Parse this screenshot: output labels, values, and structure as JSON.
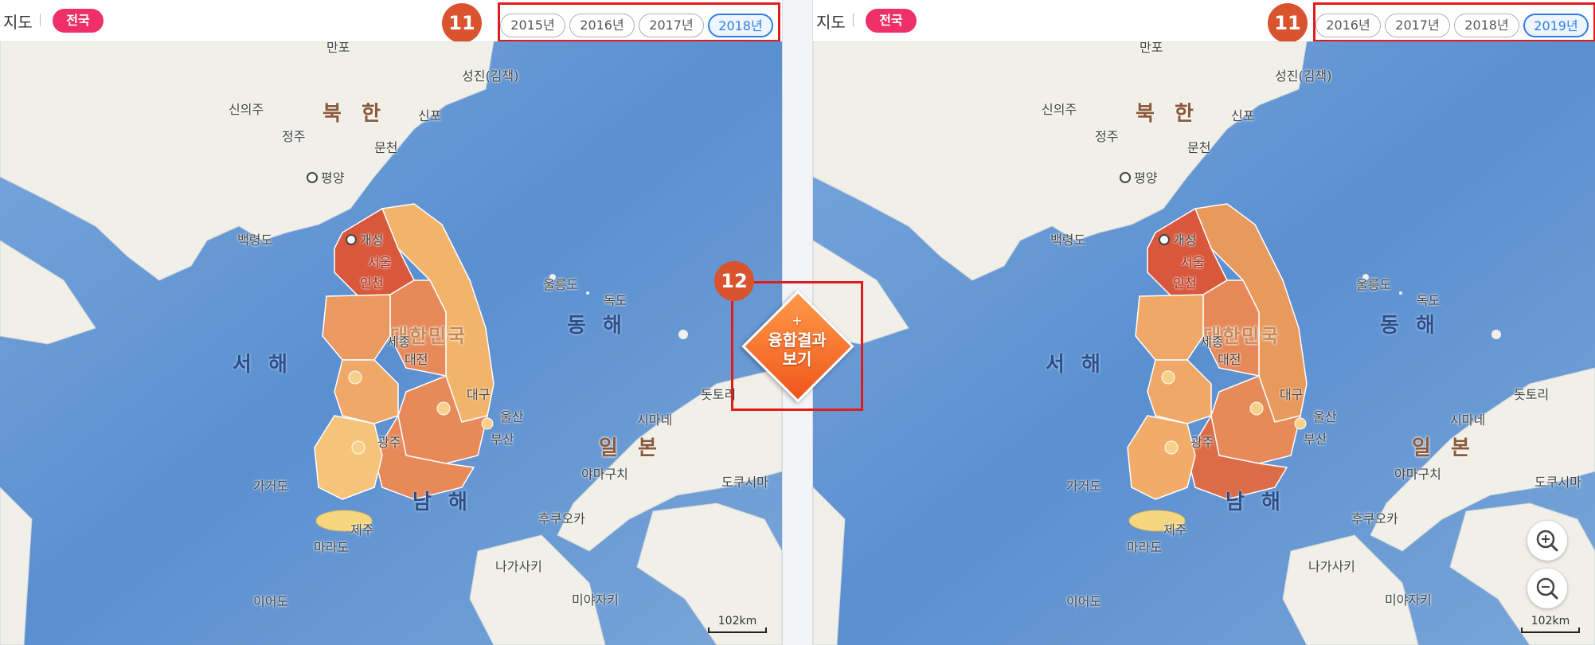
{
  "left": {
    "map_label": "지도",
    "region": "전국",
    "years": [
      "2015년",
      "2016년",
      "2017년",
      "2018년"
    ],
    "active_year": "2018년",
    "badge": "11",
    "scale": "102km"
  },
  "right": {
    "map_label": "지도",
    "region": "전국",
    "years": [
      "2016년",
      "2017년",
      "2018년",
      "2019년"
    ],
    "active_year": "2019년",
    "badge": "11",
    "scale": "102km"
  },
  "fusion": {
    "badge": "12",
    "plus": "+",
    "line1": "융합결과",
    "line2": "보기"
  },
  "places": {
    "north_korea": "북 한",
    "japan": "일 본",
    "south_korea": "대한민국",
    "east_sea": "동 해",
    "west_sea": "서 해",
    "south_sea": "남 해",
    "sinuiju": "신의주",
    "jeongju": "정주",
    "sinpo": "신포",
    "munchon": "문천",
    "seongjin": "성진(김책)",
    "manpo": "만포",
    "pyongyang": "평양",
    "gaeseong": "개성",
    "baengnyeongdo": "백령도",
    "seoul": "서울",
    "incheon": "인천",
    "sejong": "세종",
    "daejeon": "대전",
    "daegu": "대구",
    "ulsan": "울산",
    "busan": "부산",
    "gwangju": "광주",
    "ulleungdo": "울릉도",
    "dokdo": "독도",
    "geogeodo": "가거도",
    "jeju": "제주",
    "marado": "마라도",
    "ieodo": "이어도",
    "dottori": "돗토리",
    "shimane": "시마네",
    "yamaguchi": "야마구치",
    "tokushima": "도쿠시마",
    "fukuoka": "후쿠오카",
    "nagasaki": "나가사키",
    "miyazaki": "미야자키"
  },
  "colors": {
    "sea": "#5a8fd0",
    "land": "#f0efe8",
    "active_chip": "#ee2f68",
    "highlight_box": "#e21c1c",
    "badge": "#d9532f",
    "active_year": "#2d7fe6",
    "choropleth_high": "#d9573a",
    "choropleth_mid": "#e8895a",
    "choropleth_low": "#f2b46a",
    "choropleth_lowest": "#f7d089"
  }
}
